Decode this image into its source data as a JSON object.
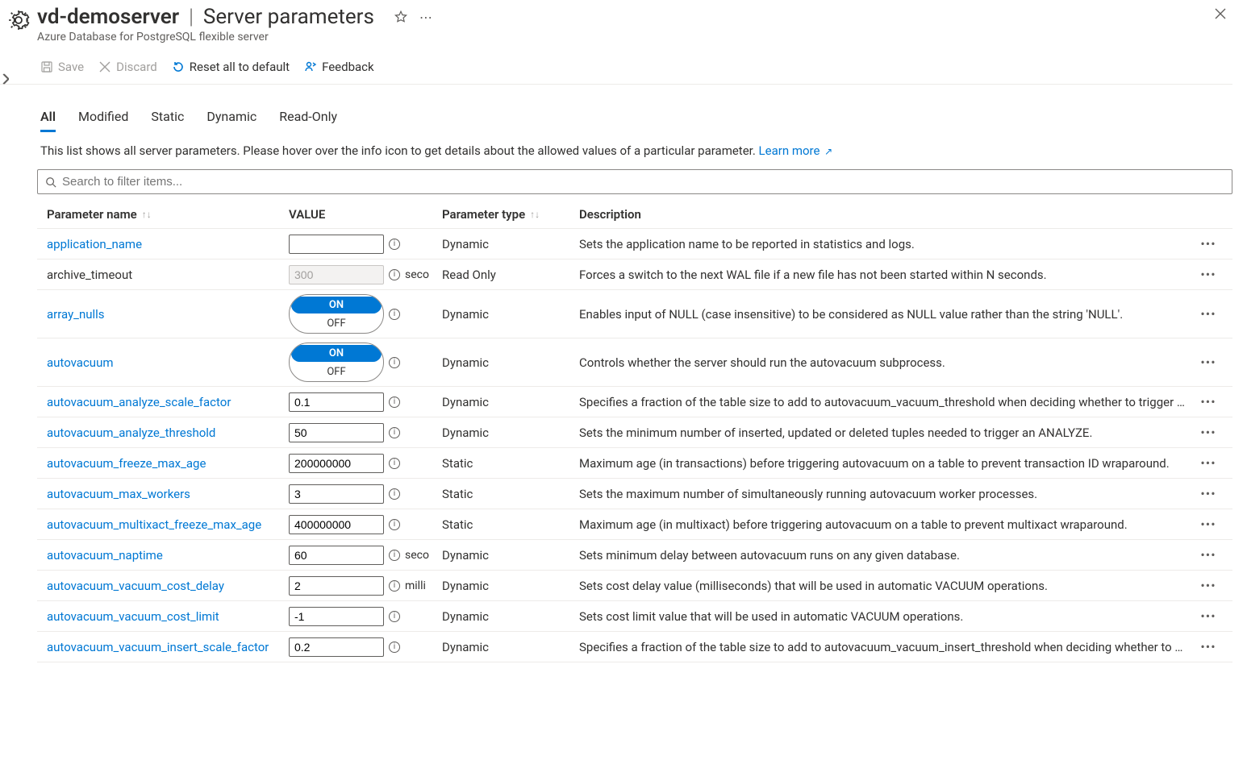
{
  "header": {
    "resource_name": "vd-demoserver",
    "page_name": "Server parameters",
    "subtitle": "Azure Database for PostgreSQL flexible server"
  },
  "toolbar": {
    "save": "Save",
    "discard": "Discard",
    "reset": "Reset all to default",
    "feedback": "Feedback"
  },
  "tabs": [
    "All",
    "Modified",
    "Static",
    "Dynamic",
    "Read-Only"
  ],
  "active_tab_index": 0,
  "info_text": "This list shows all server parameters. Please hover over the info icon to get details about the allowed values of a particular parameter.",
  "learn_more": "Learn more",
  "search_placeholder": "Search to filter items...",
  "columns": {
    "name": "Parameter name",
    "value": "VALUE",
    "type": "Parameter type",
    "desc": "Description"
  },
  "toggle_labels": {
    "on": "ON",
    "off": "OFF"
  },
  "rows": [
    {
      "name": "application_name",
      "kind": "text",
      "value": "",
      "unit": "",
      "type": "Dynamic",
      "link": true,
      "desc": "Sets the application name to be reported in statistics and logs."
    },
    {
      "name": "archive_timeout",
      "kind": "text",
      "value": "300",
      "unit": "seco",
      "type": "Read Only",
      "link": false,
      "readonly": true,
      "desc": "Forces a switch to the next WAL file if a new file has not been started within N seconds."
    },
    {
      "name": "array_nulls",
      "kind": "toggle",
      "value": "ON",
      "unit": "",
      "type": "Dynamic",
      "link": true,
      "desc": "Enables input of NULL (case insensitive) to be considered as NULL value rather than the string 'NULL'."
    },
    {
      "name": "autovacuum",
      "kind": "toggle",
      "value": "ON",
      "unit": "",
      "type": "Dynamic",
      "link": true,
      "desc": "Controls whether the server should run the autovacuum subprocess."
    },
    {
      "name": "autovacuum_analyze_scale_factor",
      "kind": "text",
      "value": "0.1",
      "unit": "",
      "type": "Dynamic",
      "link": true,
      "desc": "Specifies a fraction of the table size to add to autovacuum_vacuum_threshold when deciding whether to trigger an ANALYZE."
    },
    {
      "name": "autovacuum_analyze_threshold",
      "kind": "text",
      "value": "50",
      "unit": "",
      "type": "Dynamic",
      "link": true,
      "desc": "Sets the minimum number of inserted, updated or deleted tuples needed to trigger an ANALYZE."
    },
    {
      "name": "autovacuum_freeze_max_age",
      "kind": "text",
      "value": "200000000",
      "unit": "",
      "type": "Static",
      "link": true,
      "desc": "Maximum age (in transactions) before triggering autovacuum on a table to prevent transaction ID wraparound."
    },
    {
      "name": "autovacuum_max_workers",
      "kind": "text",
      "value": "3",
      "unit": "",
      "type": "Static",
      "link": true,
      "desc": "Sets the maximum number of simultaneously running autovacuum worker processes."
    },
    {
      "name": "autovacuum_multixact_freeze_max_age",
      "kind": "text",
      "value": "400000000",
      "unit": "",
      "type": "Static",
      "link": true,
      "desc": "Maximum age (in multixact) before triggering autovacuum on a table to prevent multixact wraparound."
    },
    {
      "name": "autovacuum_naptime",
      "kind": "text",
      "value": "60",
      "unit": "seco",
      "type": "Dynamic",
      "link": true,
      "desc": "Sets minimum delay between autovacuum runs on any given database."
    },
    {
      "name": "autovacuum_vacuum_cost_delay",
      "kind": "text",
      "value": "2",
      "unit": "milli",
      "type": "Dynamic",
      "link": true,
      "desc": "Sets cost delay value (milliseconds) that will be used in automatic VACUUM operations."
    },
    {
      "name": "autovacuum_vacuum_cost_limit",
      "kind": "text",
      "value": "-1",
      "unit": "",
      "type": "Dynamic",
      "link": true,
      "desc": "Sets cost limit value that will be used in automatic VACUUM operations."
    },
    {
      "name": "autovacuum_vacuum_insert_scale_factor",
      "kind": "text",
      "value": "0.2",
      "unit": "",
      "type": "Dynamic",
      "link": true,
      "desc": "Specifies a fraction of the table size to add to autovacuum_vacuum_insert_threshold when deciding whether to trigger a VACUUM."
    }
  ]
}
